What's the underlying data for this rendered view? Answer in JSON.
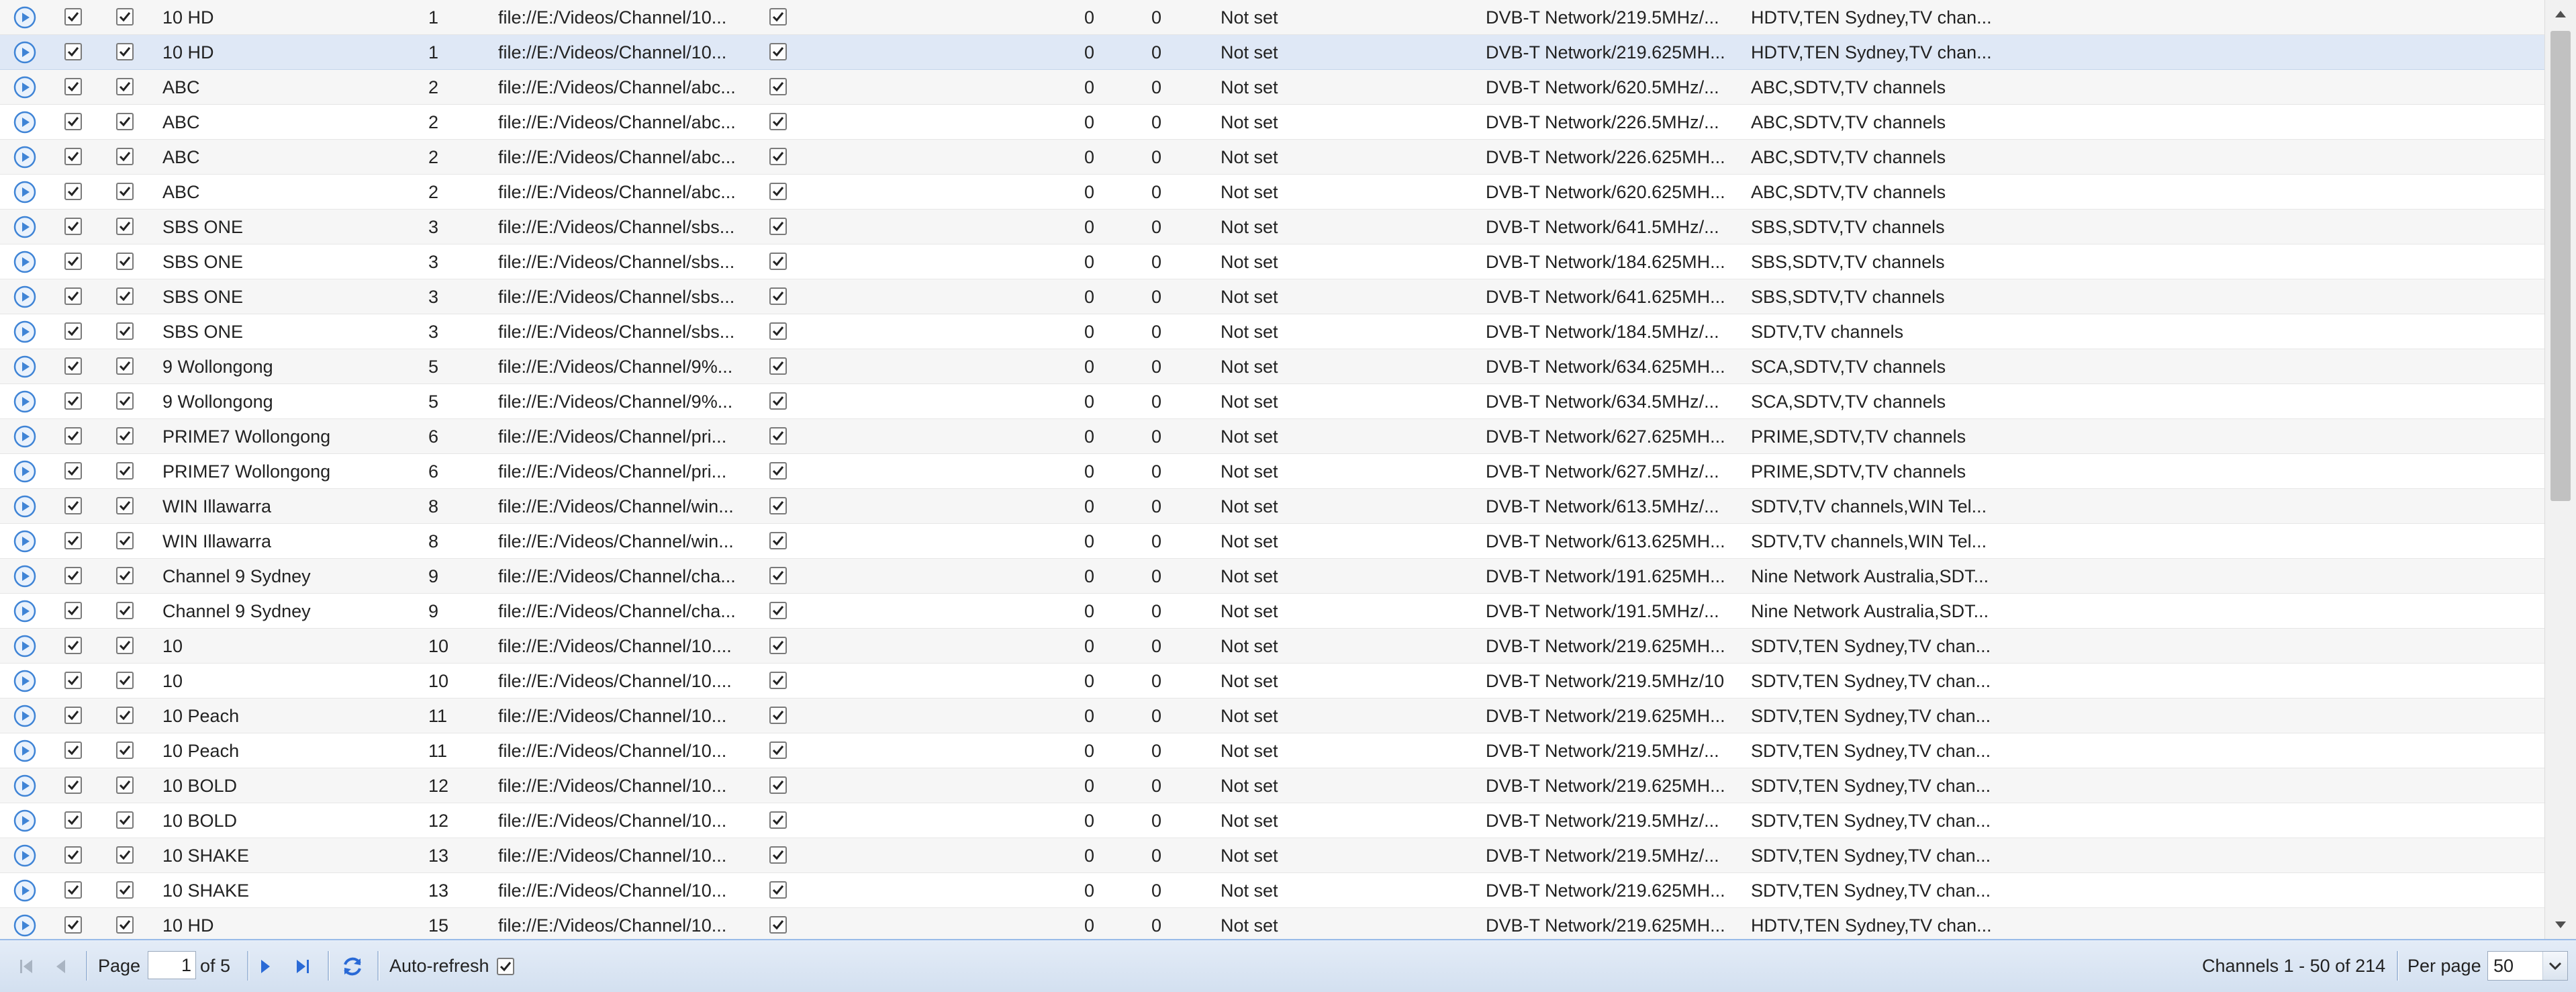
{
  "grid": {
    "selected_row_index": 1,
    "rows": [
      {
        "name": "10 HD",
        "number": "1",
        "file": "file://E:/Videos/Channel/10...",
        "v1": "0",
        "v2": "0",
        "status": "Not set",
        "network": "DVB-T Network/219.5MHz/...",
        "groups": "HDTV,TEN Sydney,TV chan..."
      },
      {
        "name": "10 HD",
        "number": "1",
        "file": "file://E:/Videos/Channel/10...",
        "v1": "0",
        "v2": "0",
        "status": "Not set",
        "network": "DVB-T Network/219.625MH...",
        "groups": "HDTV,TEN Sydney,TV chan..."
      },
      {
        "name": "ABC",
        "number": "2",
        "file": "file://E:/Videos/Channel/abc...",
        "v1": "0",
        "v2": "0",
        "status": "Not set",
        "network": "DVB-T Network/620.5MHz/...",
        "groups": "ABC,SDTV,TV channels"
      },
      {
        "name": "ABC",
        "number": "2",
        "file": "file://E:/Videos/Channel/abc...",
        "v1": "0",
        "v2": "0",
        "status": "Not set",
        "network": "DVB-T Network/226.5MHz/...",
        "groups": "ABC,SDTV,TV channels"
      },
      {
        "name": "ABC",
        "number": "2",
        "file": "file://E:/Videos/Channel/abc...",
        "v1": "0",
        "v2": "0",
        "status": "Not set",
        "network": "DVB-T Network/226.625MH...",
        "groups": "ABC,SDTV,TV channels"
      },
      {
        "name": "ABC",
        "number": "2",
        "file": "file://E:/Videos/Channel/abc...",
        "v1": "0",
        "v2": "0",
        "status": "Not set",
        "network": "DVB-T Network/620.625MH...",
        "groups": "ABC,SDTV,TV channels"
      },
      {
        "name": "SBS ONE",
        "number": "3",
        "file": "file://E:/Videos/Channel/sbs...",
        "v1": "0",
        "v2": "0",
        "status": "Not set",
        "network": "DVB-T Network/641.5MHz/...",
        "groups": "SBS,SDTV,TV channels"
      },
      {
        "name": "SBS ONE",
        "number": "3",
        "file": "file://E:/Videos/Channel/sbs...",
        "v1": "0",
        "v2": "0",
        "status": "Not set",
        "network": "DVB-T Network/184.625MH...",
        "groups": "SBS,SDTV,TV channels"
      },
      {
        "name": "SBS ONE",
        "number": "3",
        "file": "file://E:/Videos/Channel/sbs...",
        "v1": "0",
        "v2": "0",
        "status": "Not set",
        "network": "DVB-T Network/641.625MH...",
        "groups": "SBS,SDTV,TV channels"
      },
      {
        "name": "SBS ONE",
        "number": "3",
        "file": "file://E:/Videos/Channel/sbs...",
        "v1": "0",
        "v2": "0",
        "status": "Not set",
        "network": "DVB-T Network/184.5MHz/...",
        "groups": "SDTV,TV channels"
      },
      {
        "name": "9 Wollongong",
        "number": "5",
        "file": "file://E:/Videos/Channel/9%...",
        "v1": "0",
        "v2": "0",
        "status": "Not set",
        "network": "DVB-T Network/634.625MH...",
        "groups": "SCA,SDTV,TV channels"
      },
      {
        "name": "9 Wollongong",
        "number": "5",
        "file": "file://E:/Videos/Channel/9%...",
        "v1": "0",
        "v2": "0",
        "status": "Not set",
        "network": "DVB-T Network/634.5MHz/...",
        "groups": "SCA,SDTV,TV channels"
      },
      {
        "name": "PRIME7 Wollongong",
        "number": "6",
        "file": "file://E:/Videos/Channel/pri...",
        "v1": "0",
        "v2": "0",
        "status": "Not set",
        "network": "DVB-T Network/627.625MH...",
        "groups": "PRIME,SDTV,TV channels"
      },
      {
        "name": "PRIME7 Wollongong",
        "number": "6",
        "file": "file://E:/Videos/Channel/pri...",
        "v1": "0",
        "v2": "0",
        "status": "Not set",
        "network": "DVB-T Network/627.5MHz/...",
        "groups": "PRIME,SDTV,TV channels"
      },
      {
        "name": "WIN Illawarra",
        "number": "8",
        "file": "file://E:/Videos/Channel/win...",
        "v1": "0",
        "v2": "0",
        "status": "Not set",
        "network": "DVB-T Network/613.5MHz/...",
        "groups": "SDTV,TV channels,WIN Tel..."
      },
      {
        "name": "WIN Illawarra",
        "number": "8",
        "file": "file://E:/Videos/Channel/win...",
        "v1": "0",
        "v2": "0",
        "status": "Not set",
        "network": "DVB-T Network/613.625MH...",
        "groups": "SDTV,TV channels,WIN Tel..."
      },
      {
        "name": "Channel 9 Sydney",
        "number": "9",
        "file": "file://E:/Videos/Channel/cha...",
        "v1": "0",
        "v2": "0",
        "status": "Not set",
        "network": "DVB-T Network/191.625MH...",
        "groups": "Nine Network Australia,SDT..."
      },
      {
        "name": "Channel 9 Sydney",
        "number": "9",
        "file": "file://E:/Videos/Channel/cha...",
        "v1": "0",
        "v2": "0",
        "status": "Not set",
        "network": "DVB-T Network/191.5MHz/...",
        "groups": "Nine Network Australia,SDT..."
      },
      {
        "name": "10",
        "number": "10",
        "file": "file://E:/Videos/Channel/10....",
        "v1": "0",
        "v2": "0",
        "status": "Not set",
        "network": "DVB-T Network/219.625MH...",
        "groups": "SDTV,TEN Sydney,TV chan..."
      },
      {
        "name": "10",
        "number": "10",
        "file": "file://E:/Videos/Channel/10....",
        "v1": "0",
        "v2": "0",
        "status": "Not set",
        "network": "DVB-T Network/219.5MHz/10",
        "groups": "SDTV,TEN Sydney,TV chan..."
      },
      {
        "name": "10 Peach",
        "number": "11",
        "file": "file://E:/Videos/Channel/10...",
        "v1": "0",
        "v2": "0",
        "status": "Not set",
        "network": "DVB-T Network/219.625MH...",
        "groups": "SDTV,TEN Sydney,TV chan..."
      },
      {
        "name": "10 Peach",
        "number": "11",
        "file": "file://E:/Videos/Channel/10...",
        "v1": "0",
        "v2": "0",
        "status": "Not set",
        "network": "DVB-T Network/219.5MHz/...",
        "groups": "SDTV,TEN Sydney,TV chan..."
      },
      {
        "name": "10 BOLD",
        "number": "12",
        "file": "file://E:/Videos/Channel/10...",
        "v1": "0",
        "v2": "0",
        "status": "Not set",
        "network": "DVB-T Network/219.625MH...",
        "groups": "SDTV,TEN Sydney,TV chan..."
      },
      {
        "name": "10 BOLD",
        "number": "12",
        "file": "file://E:/Videos/Channel/10...",
        "v1": "0",
        "v2": "0",
        "status": "Not set",
        "network": "DVB-T Network/219.5MHz/...",
        "groups": "SDTV,TEN Sydney,TV chan..."
      },
      {
        "name": "10 SHAKE",
        "number": "13",
        "file": "file://E:/Videos/Channel/10...",
        "v1": "0",
        "v2": "0",
        "status": "Not set",
        "network": "DVB-T Network/219.5MHz/...",
        "groups": "SDTV,TEN Sydney,TV chan..."
      },
      {
        "name": "10 SHAKE",
        "number": "13",
        "file": "file://E:/Videos/Channel/10...",
        "v1": "0",
        "v2": "0",
        "status": "Not set",
        "network": "DVB-T Network/219.625MH...",
        "groups": "SDTV,TEN Sydney,TV chan..."
      },
      {
        "name": "10 HD",
        "number": "15",
        "file": "file://E:/Videos/Channel/10...",
        "v1": "0",
        "v2": "0",
        "status": "Not set",
        "network": "DVB-T Network/219.625MH...",
        "groups": "HDTV,TEN Sydney,TV chan..."
      }
    ]
  },
  "toolbar": {
    "page_label": "Page",
    "page_value": "1",
    "page_of": "of 5",
    "auto_refresh_label": "Auto-refresh",
    "auto_refresh_checked": true,
    "display_info": "Channels 1 - 50 of 214",
    "per_page_label": "Per page",
    "per_page_value": "50"
  },
  "icons": {
    "row_play": "play-circle-icon",
    "first": "first-page-icon",
    "prev": "prev-page-icon",
    "next": "next-page-icon",
    "last": "last-page-icon",
    "refresh": "refresh-icon",
    "dropdown": "chevron-down-icon"
  },
  "colors": {
    "selected_row": "#dfe8f6",
    "toolbar": "#d3e0f0",
    "play_icon": "#3f84d6",
    "nav_icon": "#2a6ad6"
  }
}
